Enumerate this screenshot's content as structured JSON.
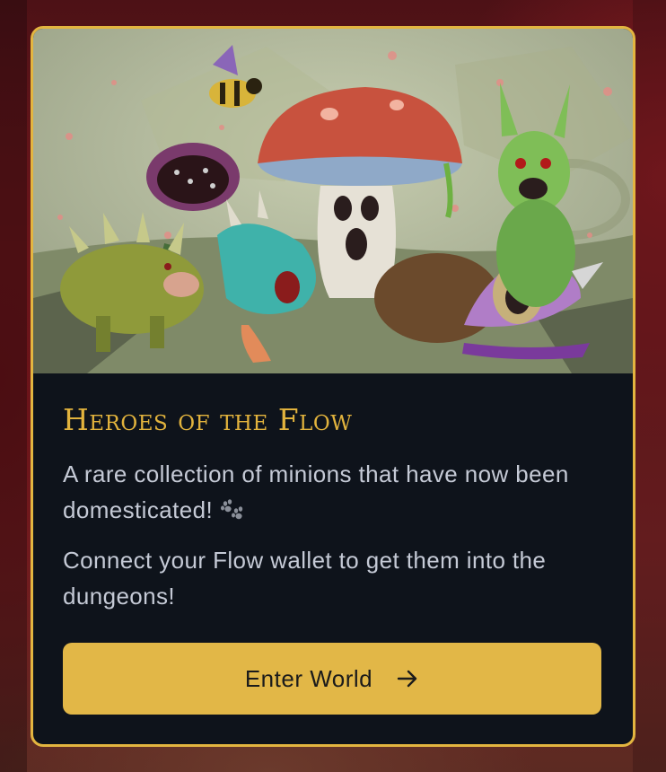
{
  "card": {
    "title": "Heroes of the Flow",
    "description_1": "A rare collection of minions that have now been domesticated!",
    "description_2": "Connect your Flow wallet to get them into the dungeons!",
    "description_1_icon": "paw-prints-icon",
    "artwork": "monster-collection-artwork"
  },
  "button": {
    "label": "Enter World",
    "icon": "arrow-right-icon"
  },
  "colors": {
    "accent": "#e3b540",
    "card_background": "#0e131b",
    "text": "#c5cad6",
    "button_text": "#1b1b1b"
  }
}
